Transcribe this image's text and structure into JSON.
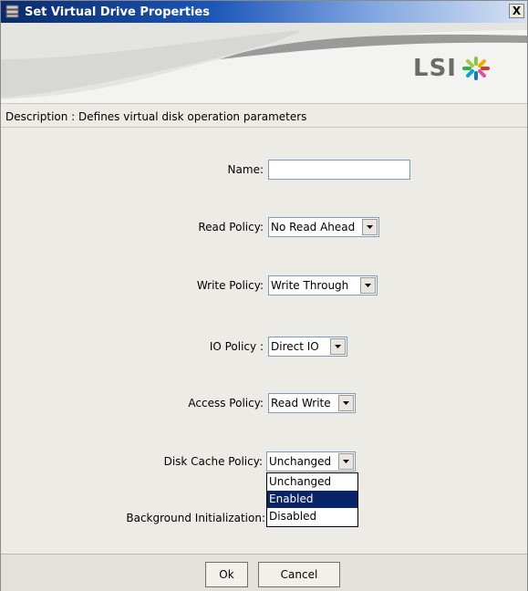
{
  "window": {
    "title": "Set Virtual Drive Properties",
    "close_label": "X"
  },
  "banner": {
    "logo_text": "LSI"
  },
  "description": "Description : Defines virtual disk operation parameters",
  "form": {
    "name_label": "Name:",
    "name_value": "",
    "read_policy_label": "Read Policy:",
    "read_policy_value": "No Read Ahead",
    "write_policy_label": "Write Policy:",
    "write_policy_value": "Write Through",
    "io_policy_label": "IO Policy :",
    "io_policy_value": "Direct IO",
    "access_policy_label": "Access Policy:",
    "access_policy_value": "Read Write",
    "disk_cache_policy_label": "Disk Cache Policy:",
    "disk_cache_policy_value": "Unchanged",
    "background_init_label": "Background Initialization:"
  },
  "disk_cache_options": [
    {
      "label": "Unchanged",
      "selected": false
    },
    {
      "label": "Enabled",
      "selected": true
    },
    {
      "label": "Disabled",
      "selected": false
    }
  ],
  "buttons": {
    "ok_label": "Ok",
    "cancel_label": "Cancel"
  },
  "colors": {
    "titlebar": "#0a2a6e",
    "selection": "#0a246a"
  }
}
